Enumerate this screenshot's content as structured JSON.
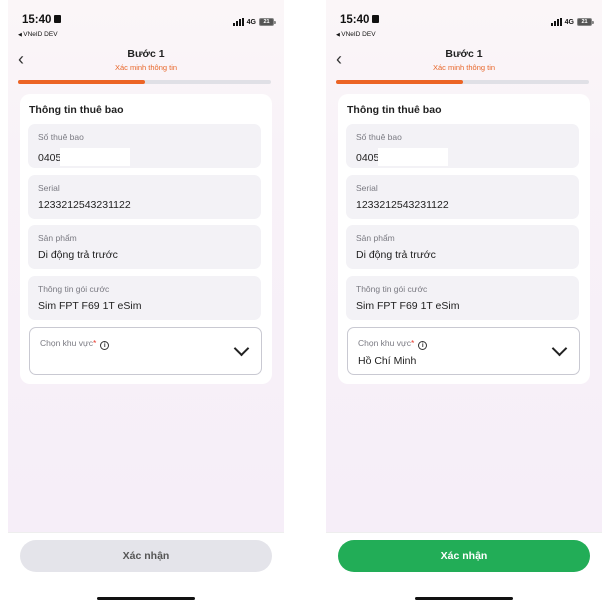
{
  "screens": [
    {
      "status": {
        "time": "15:40",
        "carrier": "VNeID DEV",
        "network": "4G",
        "battery": "21"
      },
      "header": {
        "title": "Bước 1",
        "subtitle": "Xác minh thông tin"
      },
      "progress": 0.5,
      "card": {
        "title": "Thông tin thuê bao",
        "fields": [
          {
            "label": "Số thuê bao",
            "value": "0405:"
          },
          {
            "label": "Serial",
            "value": "1233212543231122"
          },
          {
            "label": "Sản phẩm",
            "value": "Di động trả trước"
          },
          {
            "label": "Thông tin gói cước",
            "value": "Sim FPT F69 1T eSim"
          }
        ],
        "region": {
          "label": "Chọn khu vực",
          "required_mark": "*",
          "value": ""
        }
      },
      "confirm": {
        "label": "Xác nhận",
        "state": "disabled",
        "color": "#e4e4ea"
      }
    },
    {
      "status": {
        "time": "15:40",
        "carrier": "VNeID DEV",
        "network": "4G",
        "battery": "21"
      },
      "header": {
        "title": "Bước 1",
        "subtitle": "Xác minh thông tin"
      },
      "progress": 0.5,
      "card": {
        "title": "Thông tin thuê bao",
        "fields": [
          {
            "label": "Số thuê bao",
            "value": "0405:"
          },
          {
            "label": "Serial",
            "value": "1233212543231122"
          },
          {
            "label": "Sản phẩm",
            "value": "Di động trả trước"
          },
          {
            "label": "Thông tin gói cước",
            "value": "Sim FPT F69 1T eSim"
          }
        ],
        "region": {
          "label": "Chọn khu vực",
          "required_mark": "*",
          "value": "Hồ Chí Minh"
        }
      },
      "confirm": {
        "label": "Xác nhận",
        "state": "active",
        "color": "#22ad57"
      }
    }
  ],
  "colors": {
    "accent": "#ec6425",
    "success": "#22ad57",
    "required": "#e63a2e"
  },
  "icons": {
    "back": "chevron-left-icon",
    "dropdown": "chevron-down-icon",
    "info": "info-icon"
  }
}
